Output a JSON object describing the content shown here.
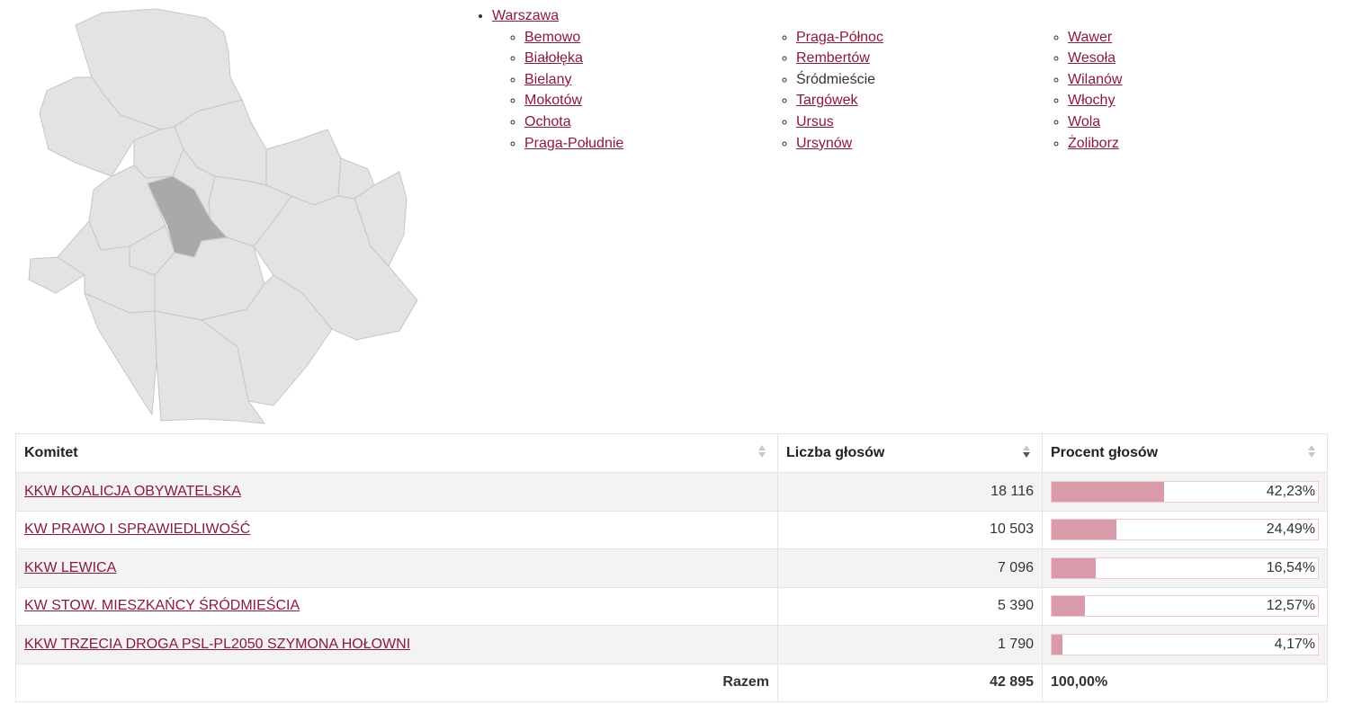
{
  "navigation": {
    "city": "Warszawa",
    "columns": [
      [
        {
          "label": "Bemowo",
          "link": true
        },
        {
          "label": "Białołęka",
          "link": true
        },
        {
          "label": "Bielany",
          "link": true
        },
        {
          "label": "Mokotów",
          "link": true
        },
        {
          "label": "Ochota",
          "link": true
        },
        {
          "label": "Praga-Południe",
          "link": true
        }
      ],
      [
        {
          "label": "Praga-Północ",
          "link": true
        },
        {
          "label": "Rembertów",
          "link": true
        },
        {
          "label": "Śródmieście",
          "link": false
        },
        {
          "label": "Targówek",
          "link": true
        },
        {
          "label": "Ursus",
          "link": true
        },
        {
          "label": "Ursynów",
          "link": true
        }
      ],
      [
        {
          "label": "Wawer",
          "link": true
        },
        {
          "label": "Wesoła",
          "link": true
        },
        {
          "label": "Wilanów",
          "link": true
        },
        {
          "label": "Włochy",
          "link": true
        },
        {
          "label": "Wola",
          "link": true
        },
        {
          "label": "Żoliborz",
          "link": true
        }
      ]
    ]
  },
  "map": {
    "highlighted_district": "Śródmieście",
    "fill_color": "#e3e3e3",
    "highlight_color": "#a9a9a9",
    "border_color": "#c6c6c6"
  },
  "table": {
    "headers": {
      "committee": "Komitet",
      "votes": "Liczba głosów",
      "percent": "Procent głosów"
    },
    "sorted_by": "votes",
    "rows": [
      {
        "committee": "KKW KOALICJA OBYWATELSKA",
        "votes": "18 116",
        "percent": "42,23%",
        "share": 42.23
      },
      {
        "committee": "KW PRAWO I SPRAWIEDLIWOŚĆ",
        "votes": "10 503",
        "percent": "24,49%",
        "share": 24.49
      },
      {
        "committee": "KKW LEWICA",
        "votes": "7 096",
        "percent": "16,54%",
        "share": 16.54
      },
      {
        "committee": "KW STOW. MIESZKAŃCY ŚRÓDMIEŚCIA",
        "votes": "5 390",
        "percent": "12,57%",
        "share": 12.57
      },
      {
        "committee": "KKW TRZECIA DROGA PSL-PL2050 SZYMONA HOŁOWNI",
        "votes": "1 790",
        "percent": "4,17%",
        "share": 4.17
      }
    ],
    "footer": {
      "label": "Razem",
      "votes": "42 895",
      "percent": "100,00%"
    },
    "accent_color": "#8b1a38",
    "bar_color": "#d99ba9"
  }
}
